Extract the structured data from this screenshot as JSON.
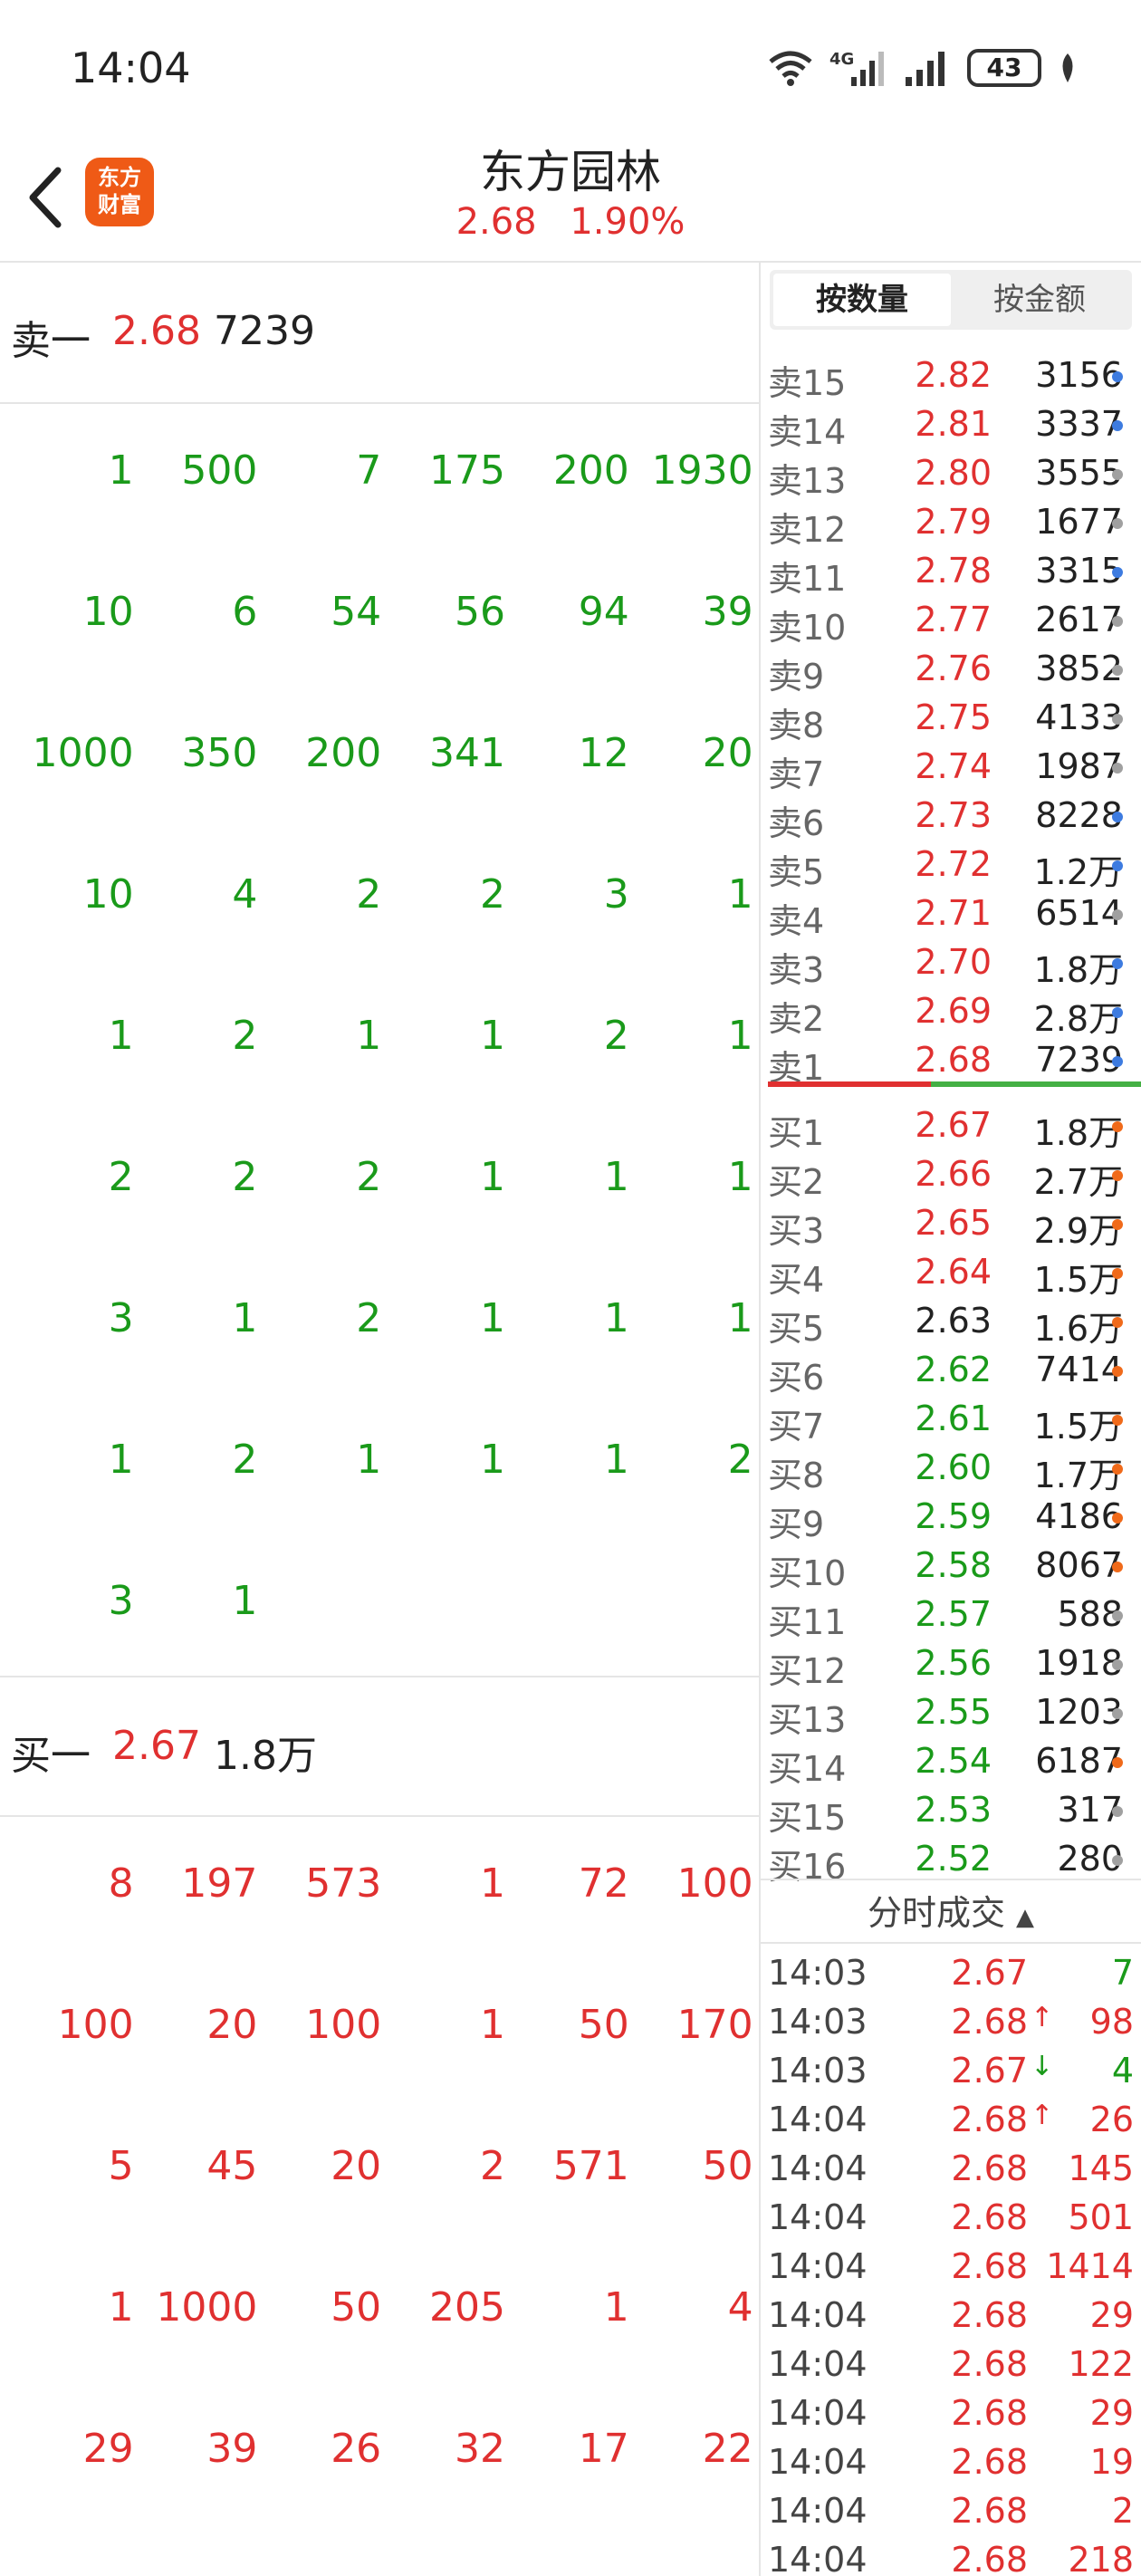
{
  "status_bar": {
    "time": "14:04",
    "network": "4G",
    "battery": "43"
  },
  "header": {
    "title": "东方园林",
    "price": "2.68",
    "change_pct": "1.90%",
    "logo_line1": "东方",
    "logo_line2": "财富"
  },
  "sell_one": {
    "label": "卖一",
    "price": "2.68",
    "volume": "7239"
  },
  "sell_queue": [
    [
      "1",
      "500",
      "7",
      "175",
      "200",
      "1930"
    ],
    [
      "10",
      "6",
      "54",
      "56",
      "94",
      "39"
    ],
    [
      "1000",
      "350",
      "200",
      "341",
      "12",
      "20"
    ],
    [
      "10",
      "4",
      "2",
      "2",
      "3",
      "1"
    ],
    [
      "1",
      "2",
      "1",
      "1",
      "2",
      "1"
    ],
    [
      "2",
      "2",
      "2",
      "1",
      "1",
      "1"
    ],
    [
      "3",
      "1",
      "2",
      "1",
      "1",
      "1"
    ],
    [
      "1",
      "2",
      "1",
      "1",
      "1",
      "2"
    ],
    [
      "3",
      "1"
    ]
  ],
  "buy_one": {
    "label": "买一",
    "price": "2.67",
    "volume": "1.8万"
  },
  "buy_queue": [
    [
      "8",
      "197",
      "573",
      "1",
      "72",
      "100"
    ],
    [
      "100",
      "20",
      "100",
      "1",
      "50",
      "170"
    ],
    [
      "5",
      "45",
      "20",
      "2",
      "571",
      "50"
    ],
    [
      "1",
      "1000",
      "50",
      "205",
      "1",
      "4"
    ],
    [
      "29",
      "39",
      "26",
      "32",
      "17",
      "22"
    ]
  ],
  "tabs": {
    "by_quantity": "按数量",
    "by_amount": "按金额"
  },
  "asks": [
    {
      "label": "卖15",
      "price": "2.82",
      "vol": "3156",
      "dot": "blue"
    },
    {
      "label": "卖14",
      "price": "2.81",
      "vol": "3337",
      "dot": "blue"
    },
    {
      "label": "卖13",
      "price": "2.80",
      "vol": "3555",
      "dot": "gray"
    },
    {
      "label": "卖12",
      "price": "2.79",
      "vol": "1677",
      "dot": "gray"
    },
    {
      "label": "卖11",
      "price": "2.78",
      "vol": "3315",
      "dot": "blue"
    },
    {
      "label": "卖10",
      "price": "2.77",
      "vol": "2617",
      "dot": "gray"
    },
    {
      "label": "卖9",
      "price": "2.76",
      "vol": "3852",
      "dot": "gray"
    },
    {
      "label": "卖8",
      "price": "2.75",
      "vol": "4133",
      "dot": "gray"
    },
    {
      "label": "卖7",
      "price": "2.74",
      "vol": "1987",
      "dot": "gray"
    },
    {
      "label": "卖6",
      "price": "2.73",
      "vol": "8228",
      "dot": "blue"
    },
    {
      "label": "卖5",
      "price": "2.72",
      "vol": "1.2万",
      "dot": "blue"
    },
    {
      "label": "卖4",
      "price": "2.71",
      "vol": "6514",
      "dot": "gray"
    },
    {
      "label": "卖3",
      "price": "2.70",
      "vol": "1.8万",
      "dot": "blue"
    },
    {
      "label": "卖2",
      "price": "2.69",
      "vol": "2.8万",
      "dot": "blue"
    },
    {
      "label": "卖1",
      "price": "2.68",
      "vol": "7239",
      "dot": "blue"
    }
  ],
  "bids": [
    {
      "label": "买1",
      "price": "2.67",
      "vol": "1.8万",
      "dot": "orange",
      "color": "red"
    },
    {
      "label": "买2",
      "price": "2.66",
      "vol": "2.7万",
      "dot": "orange",
      "color": "red"
    },
    {
      "label": "买3",
      "price": "2.65",
      "vol": "2.9万",
      "dot": "orange",
      "color": "red"
    },
    {
      "label": "买4",
      "price": "2.64",
      "vol": "1.5万",
      "dot": "orange",
      "color": "red"
    },
    {
      "label": "买5",
      "price": "2.63",
      "vol": "1.6万",
      "dot": "orange",
      "color": "black"
    },
    {
      "label": "买6",
      "price": "2.62",
      "vol": "7414",
      "dot": "orange",
      "color": "green"
    },
    {
      "label": "买7",
      "price": "2.61",
      "vol": "1.5万",
      "dot": "orange",
      "color": "green"
    },
    {
      "label": "买8",
      "price": "2.60",
      "vol": "1.7万",
      "dot": "orange",
      "color": "green"
    },
    {
      "label": "买9",
      "price": "2.59",
      "vol": "4186",
      "dot": "orange",
      "color": "green"
    },
    {
      "label": "买10",
      "price": "2.58",
      "vol": "8067",
      "dot": "orange",
      "color": "green"
    },
    {
      "label": "买11",
      "price": "2.57",
      "vol": "588",
      "dot": "gray",
      "color": "green"
    },
    {
      "label": "买12",
      "price": "2.56",
      "vol": "1918",
      "dot": "gray",
      "color": "green"
    },
    {
      "label": "买13",
      "price": "2.55",
      "vol": "1203",
      "dot": "gray",
      "color": "green"
    },
    {
      "label": "买14",
      "price": "2.54",
      "vol": "6187",
      "dot": "orange",
      "color": "green"
    },
    {
      "label": "买15",
      "price": "2.53",
      "vol": "317",
      "dot": "gray",
      "color": "green"
    },
    {
      "label": "买16",
      "price": "2.52",
      "vol": "280",
      "dot": "gray",
      "color": "green"
    }
  ],
  "trades_header": "分时成交",
  "trades": [
    {
      "time": "14:03",
      "price": "2.67",
      "arrow": "",
      "vol": "7",
      "vcolor": "green"
    },
    {
      "time": "14:03",
      "price": "2.68",
      "arrow": "↑",
      "vol": "98",
      "vcolor": "red"
    },
    {
      "time": "14:03",
      "price": "2.67",
      "arrow": "↓",
      "vol": "4",
      "vcolor": "green"
    },
    {
      "time": "14:04",
      "price": "2.68",
      "arrow": "↑",
      "vol": "26",
      "vcolor": "red"
    },
    {
      "time": "14:04",
      "price": "2.68",
      "arrow": "",
      "vol": "145",
      "vcolor": "red"
    },
    {
      "time": "14:04",
      "price": "2.68",
      "arrow": "",
      "vol": "501",
      "vcolor": "red"
    },
    {
      "time": "14:04",
      "price": "2.68",
      "arrow": "",
      "vol": "1414",
      "vcolor": "red"
    },
    {
      "time": "14:04",
      "price": "2.68",
      "arrow": "",
      "vol": "29",
      "vcolor": "red"
    },
    {
      "time": "14:04",
      "price": "2.68",
      "arrow": "",
      "vol": "122",
      "vcolor": "red"
    },
    {
      "time": "14:04",
      "price": "2.68",
      "arrow": "",
      "vol": "29",
      "vcolor": "red"
    },
    {
      "time": "14:04",
      "price": "2.68",
      "arrow": "",
      "vol": "19",
      "vcolor": "red"
    },
    {
      "time": "14:04",
      "price": "2.68",
      "arrow": "",
      "vol": "2",
      "vcolor": "red"
    },
    {
      "time": "14:04",
      "price": "2.68",
      "arrow": "",
      "vol": "218",
      "vcolor": "red"
    }
  ],
  "colors": {
    "red": "#e03030",
    "green": "#1a9a1a",
    "black": "#222222"
  }
}
